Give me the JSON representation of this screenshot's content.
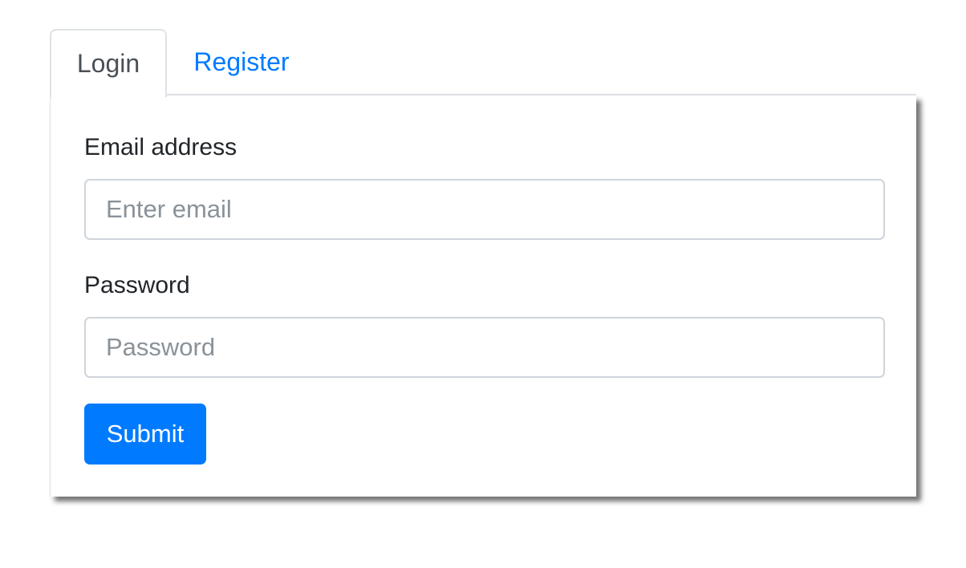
{
  "tabs": {
    "login_label": "Login",
    "register_label": "Register",
    "active": "Login"
  },
  "form": {
    "email_label": "Email address",
    "email_placeholder": "Enter email",
    "email_value": "",
    "password_label": "Password",
    "password_placeholder": "Password",
    "password_value": "",
    "submit_label": "Submit"
  },
  "colors": {
    "accent": "#007bff",
    "text": "#212529",
    "border": "#dee2e6"
  }
}
